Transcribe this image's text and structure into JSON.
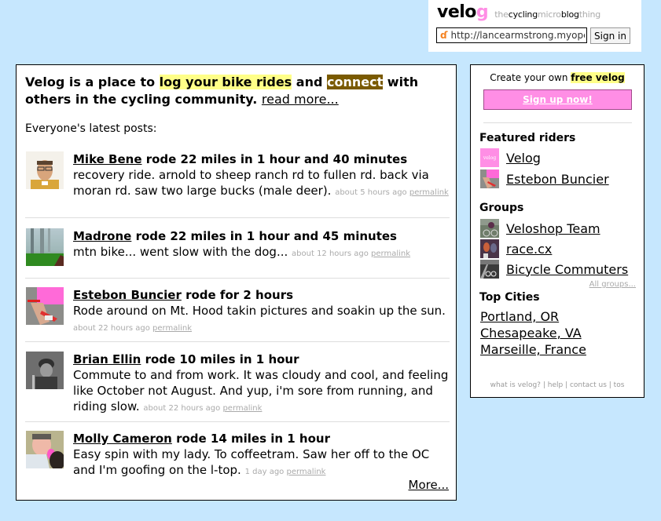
{
  "header": {
    "logo_main": "velo",
    "logo_accent": "g",
    "tagline": [
      {
        "text": "the",
        "dark": false
      },
      {
        "text": "cycling",
        "dark": true
      },
      {
        "text": "micro",
        "dark": false
      },
      {
        "text": "blog",
        "dark": true
      },
      {
        "text": "thing",
        "dark": false
      }
    ],
    "openid_icon": "openid-icon",
    "openid_value": "http://lancearmstrong.myopenid.com",
    "signin_label": "Sign in"
  },
  "intro": {
    "part1": "Velog is a place to ",
    "highlight1": "log your bike rides",
    "part2": " and ",
    "highlight2": "connect",
    "part3": " with others in the cycling community. ",
    "read_more": "read more..."
  },
  "latest_label": "Everyone's latest posts:",
  "posts": [
    {
      "user": "Mike Bene",
      "action": " rode 22 miles in 1 hour and 40 minutes",
      "body": "recovery ride. arnold to sheep ranch rd to fullen rd. back via moran rd. saw two large bucks (male deer). ",
      "time": "about 5 hours ago",
      "permalink": "permalink"
    },
    {
      "user": "Madrone",
      "action": " rode 22 miles in 1 hour and 45 minutes",
      "body": "mtn bike... went slow with the dog... ",
      "time": "about 12 hours ago",
      "permalink": "permalink"
    },
    {
      "user": "Estebon Buncier",
      "action": " rode for 2 hours",
      "body": "Rode around on Mt. Hood takin pictures and soakin up the sun. ",
      "time": "about 22 hours ago",
      "permalink": "permalink"
    },
    {
      "user": "Brian Ellin",
      "action": " rode 10 miles in 1 hour",
      "body": "Commute to and from work. It was cloudy and cool, and feeling like October not August. And yup, i'm sore from running, and riding slow. ",
      "time": "about 22 hours ago",
      "permalink": "permalink"
    },
    {
      "user": "Molly Cameron",
      "action": " rode 14 miles in 1 hour",
      "body": "Easy spin with my lady. To coffeetram. Saw her off to the OC and I'm goofing on the l-top. ",
      "time": "1 day ago",
      "permalink": "permalink"
    }
  ],
  "more_label": "More...",
  "sidebar": {
    "create_text": "Create your own ",
    "create_highlight": "free velog",
    "signup_label": "Sign up now!",
    "featured_title": "Featured riders",
    "featured": [
      {
        "name": "Velog",
        "thumb_text": "velog"
      },
      {
        "name": "Estebon Buncier",
        "thumb_text": ""
      }
    ],
    "groups_title": "Groups",
    "groups": [
      {
        "name": "Veloshop Team"
      },
      {
        "name": "race.cx"
      },
      {
        "name": "Bicycle Commuters"
      }
    ],
    "all_groups": "All groups...",
    "cities_title": "Top Cities",
    "cities": [
      "Portland, OR",
      "Chesapeake, VA",
      "Marseille, France"
    ],
    "footer_links": [
      "what is velog?",
      "help",
      "contact us",
      "tos"
    ]
  },
  "colors": {
    "background": "#c6e7fe",
    "brand_pink": "#ff8ee5",
    "highlight_yellow": "#ffff88",
    "highlight_brown": "#7a5a00"
  }
}
